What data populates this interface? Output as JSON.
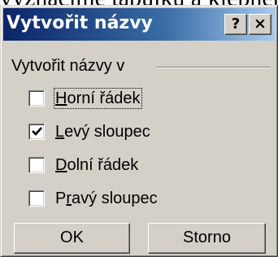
{
  "background_text": "vyznačíme tabulku a klepneme na",
  "dialog": {
    "title": "Vytvořit názvy",
    "help_glyph": "?",
    "close_glyph": "×"
  },
  "group": {
    "label": "Vytvořit názvy v"
  },
  "checkboxes": [
    {
      "accel": "H",
      "rest": "orní řádek",
      "checked": false,
      "focused": true
    },
    {
      "accel": "L",
      "rest": "evý sloupec",
      "checked": true,
      "focused": false
    },
    {
      "accel": "D",
      "rest": "olní řádek",
      "checked": false,
      "focused": false
    },
    {
      "pre": "P",
      "accel": "r",
      "rest": "avý sloupec",
      "checked": false,
      "focused": false
    }
  ],
  "buttons": {
    "ok": "OK",
    "cancel": "Storno"
  },
  "icons": {
    "help": "help-icon",
    "close": "close-icon",
    "check": "check-icon"
  },
  "colors": {
    "title_start": "#0a246a",
    "title_end": "#a6caf0",
    "face": "#d4d0c8"
  }
}
